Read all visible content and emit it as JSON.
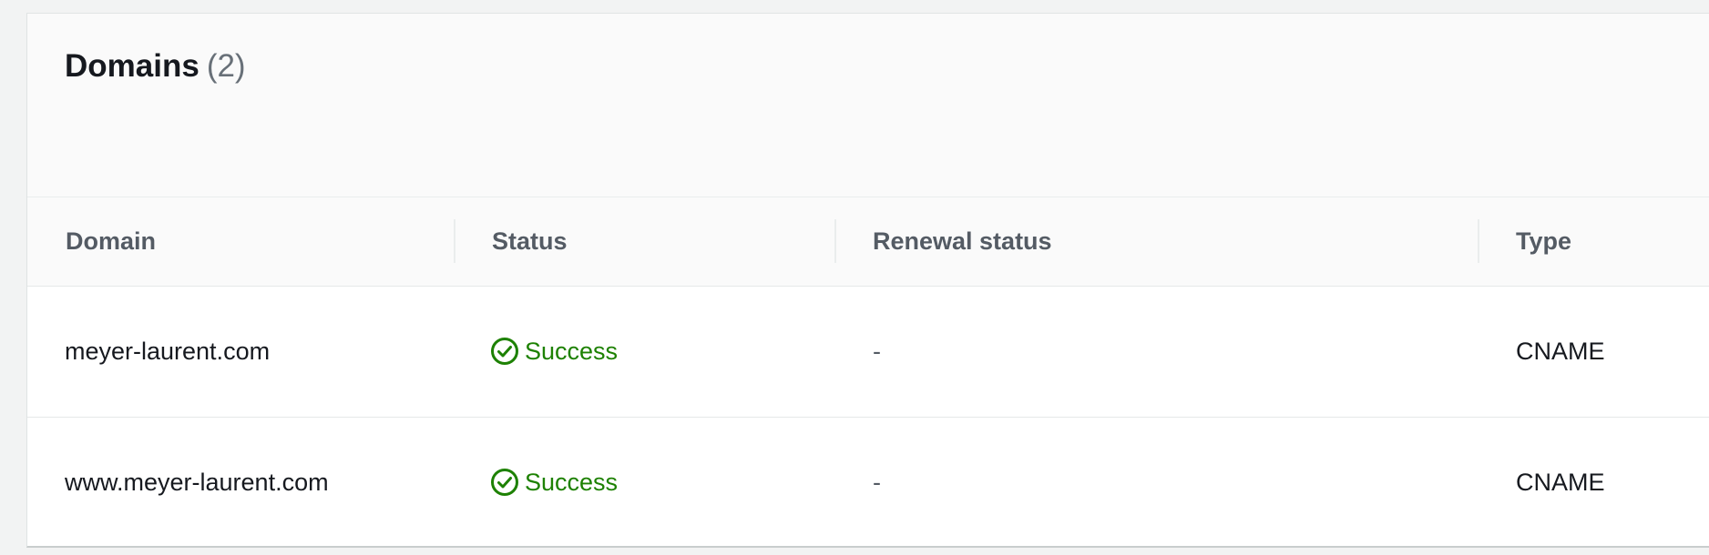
{
  "panel": {
    "title": "Domains",
    "count": "(2)"
  },
  "table": {
    "columns": [
      "Domain",
      "Status",
      "Renewal status",
      "Type"
    ],
    "rows": [
      {
        "domain": "meyer-laurent.com",
        "status": "Success",
        "renewal_status": "-",
        "type": "CNAME"
      },
      {
        "domain": "www.meyer-laurent.com",
        "status": "Success",
        "renewal_status": "-",
        "type": "CNAME"
      }
    ]
  },
  "colors": {
    "success": "#1d8102",
    "header_text": "#545b64",
    "body_text": "#16191f"
  },
  "icons": {
    "status_success": "check-circle-icon"
  }
}
